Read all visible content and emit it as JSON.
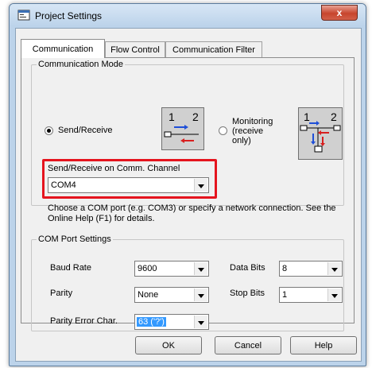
{
  "window": {
    "title": "Project Settings",
    "close_label": "x"
  },
  "tabs": [
    {
      "label": "Communication",
      "active": true
    },
    {
      "label": "Flow Control",
      "active": false
    },
    {
      "label": "Communication Filter",
      "active": false
    }
  ],
  "communication_mode": {
    "legend": "Communication Mode",
    "send_receive_label": "Send/Receive",
    "send_receive_checked": true,
    "monitoring_label_line1": "Monitoring",
    "monitoring_label_line2": "(receive",
    "monitoring_label_line3": "only)",
    "monitoring_checked": false,
    "diagram_label_1": "1",
    "diagram_label_2": "2"
  },
  "channel": {
    "label": "Send/Receive on Comm. Channel",
    "value": "COM4",
    "help_text": "Choose a COM port (e.g. COM3) or specify a network connection. See the Online Help (F1) for details."
  },
  "com_port": {
    "legend": "COM Port Settings",
    "baud_rate_label": "Baud Rate",
    "baud_rate_value": "9600",
    "data_bits_label": "Data Bits",
    "data_bits_value": "8",
    "parity_label": "Parity",
    "parity_value": "None",
    "stop_bits_label": "Stop Bits",
    "stop_bits_value": "1",
    "parity_error_label": "Parity Error Char.",
    "parity_error_value": "63 ('?')"
  },
  "buttons": {
    "ok": "OK",
    "cancel": "Cancel",
    "help": "Help"
  },
  "colors": {
    "highlight": "#e5141e",
    "selection": "#3399ff",
    "arrow_blue": "#1f4fd8",
    "arrow_red": "#d81f1f"
  }
}
